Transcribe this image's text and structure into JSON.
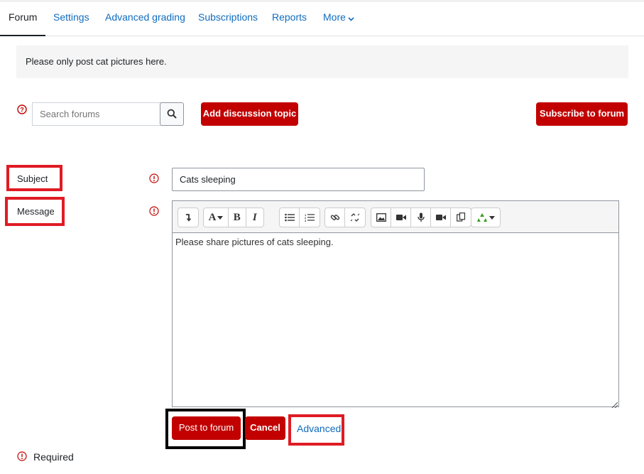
{
  "tabs": [
    {
      "label": "Forum",
      "active": true
    },
    {
      "label": "Settings"
    },
    {
      "label": "Advanced grading"
    },
    {
      "label": "Subscriptions"
    },
    {
      "label": "Reports"
    },
    {
      "label": "More"
    }
  ],
  "info": {
    "text": "Please only post cat pictures here."
  },
  "search": {
    "placeholder": "Search forums",
    "button_icon": "search-icon"
  },
  "buttons": {
    "add_topic": "Add discussion topic",
    "subscribe": "Subscribe to forum",
    "post": "Post to forum",
    "cancel": "Cancel",
    "advanced": "Advanced"
  },
  "form": {
    "subject_label": "Subject",
    "subject_value": "Cats sleeping",
    "message_label": "Message",
    "message_value": "Please share pictures of cats sleeping.",
    "required_label": "Required"
  },
  "toolbar_icons": [
    "collapse-icon",
    "font-style-icon",
    "bold-icon",
    "italic-icon",
    "unordered-list-icon",
    "ordered-list-icon",
    "link-icon",
    "unlink-icon",
    "image-icon",
    "media-icon",
    "record-audio-icon",
    "record-video-icon",
    "manage-files-icon",
    "recycle-icon"
  ],
  "colors": {
    "accent_red": "#c20000",
    "link_blue": "#0f6cbf",
    "highlight_red": "#e01b24"
  }
}
